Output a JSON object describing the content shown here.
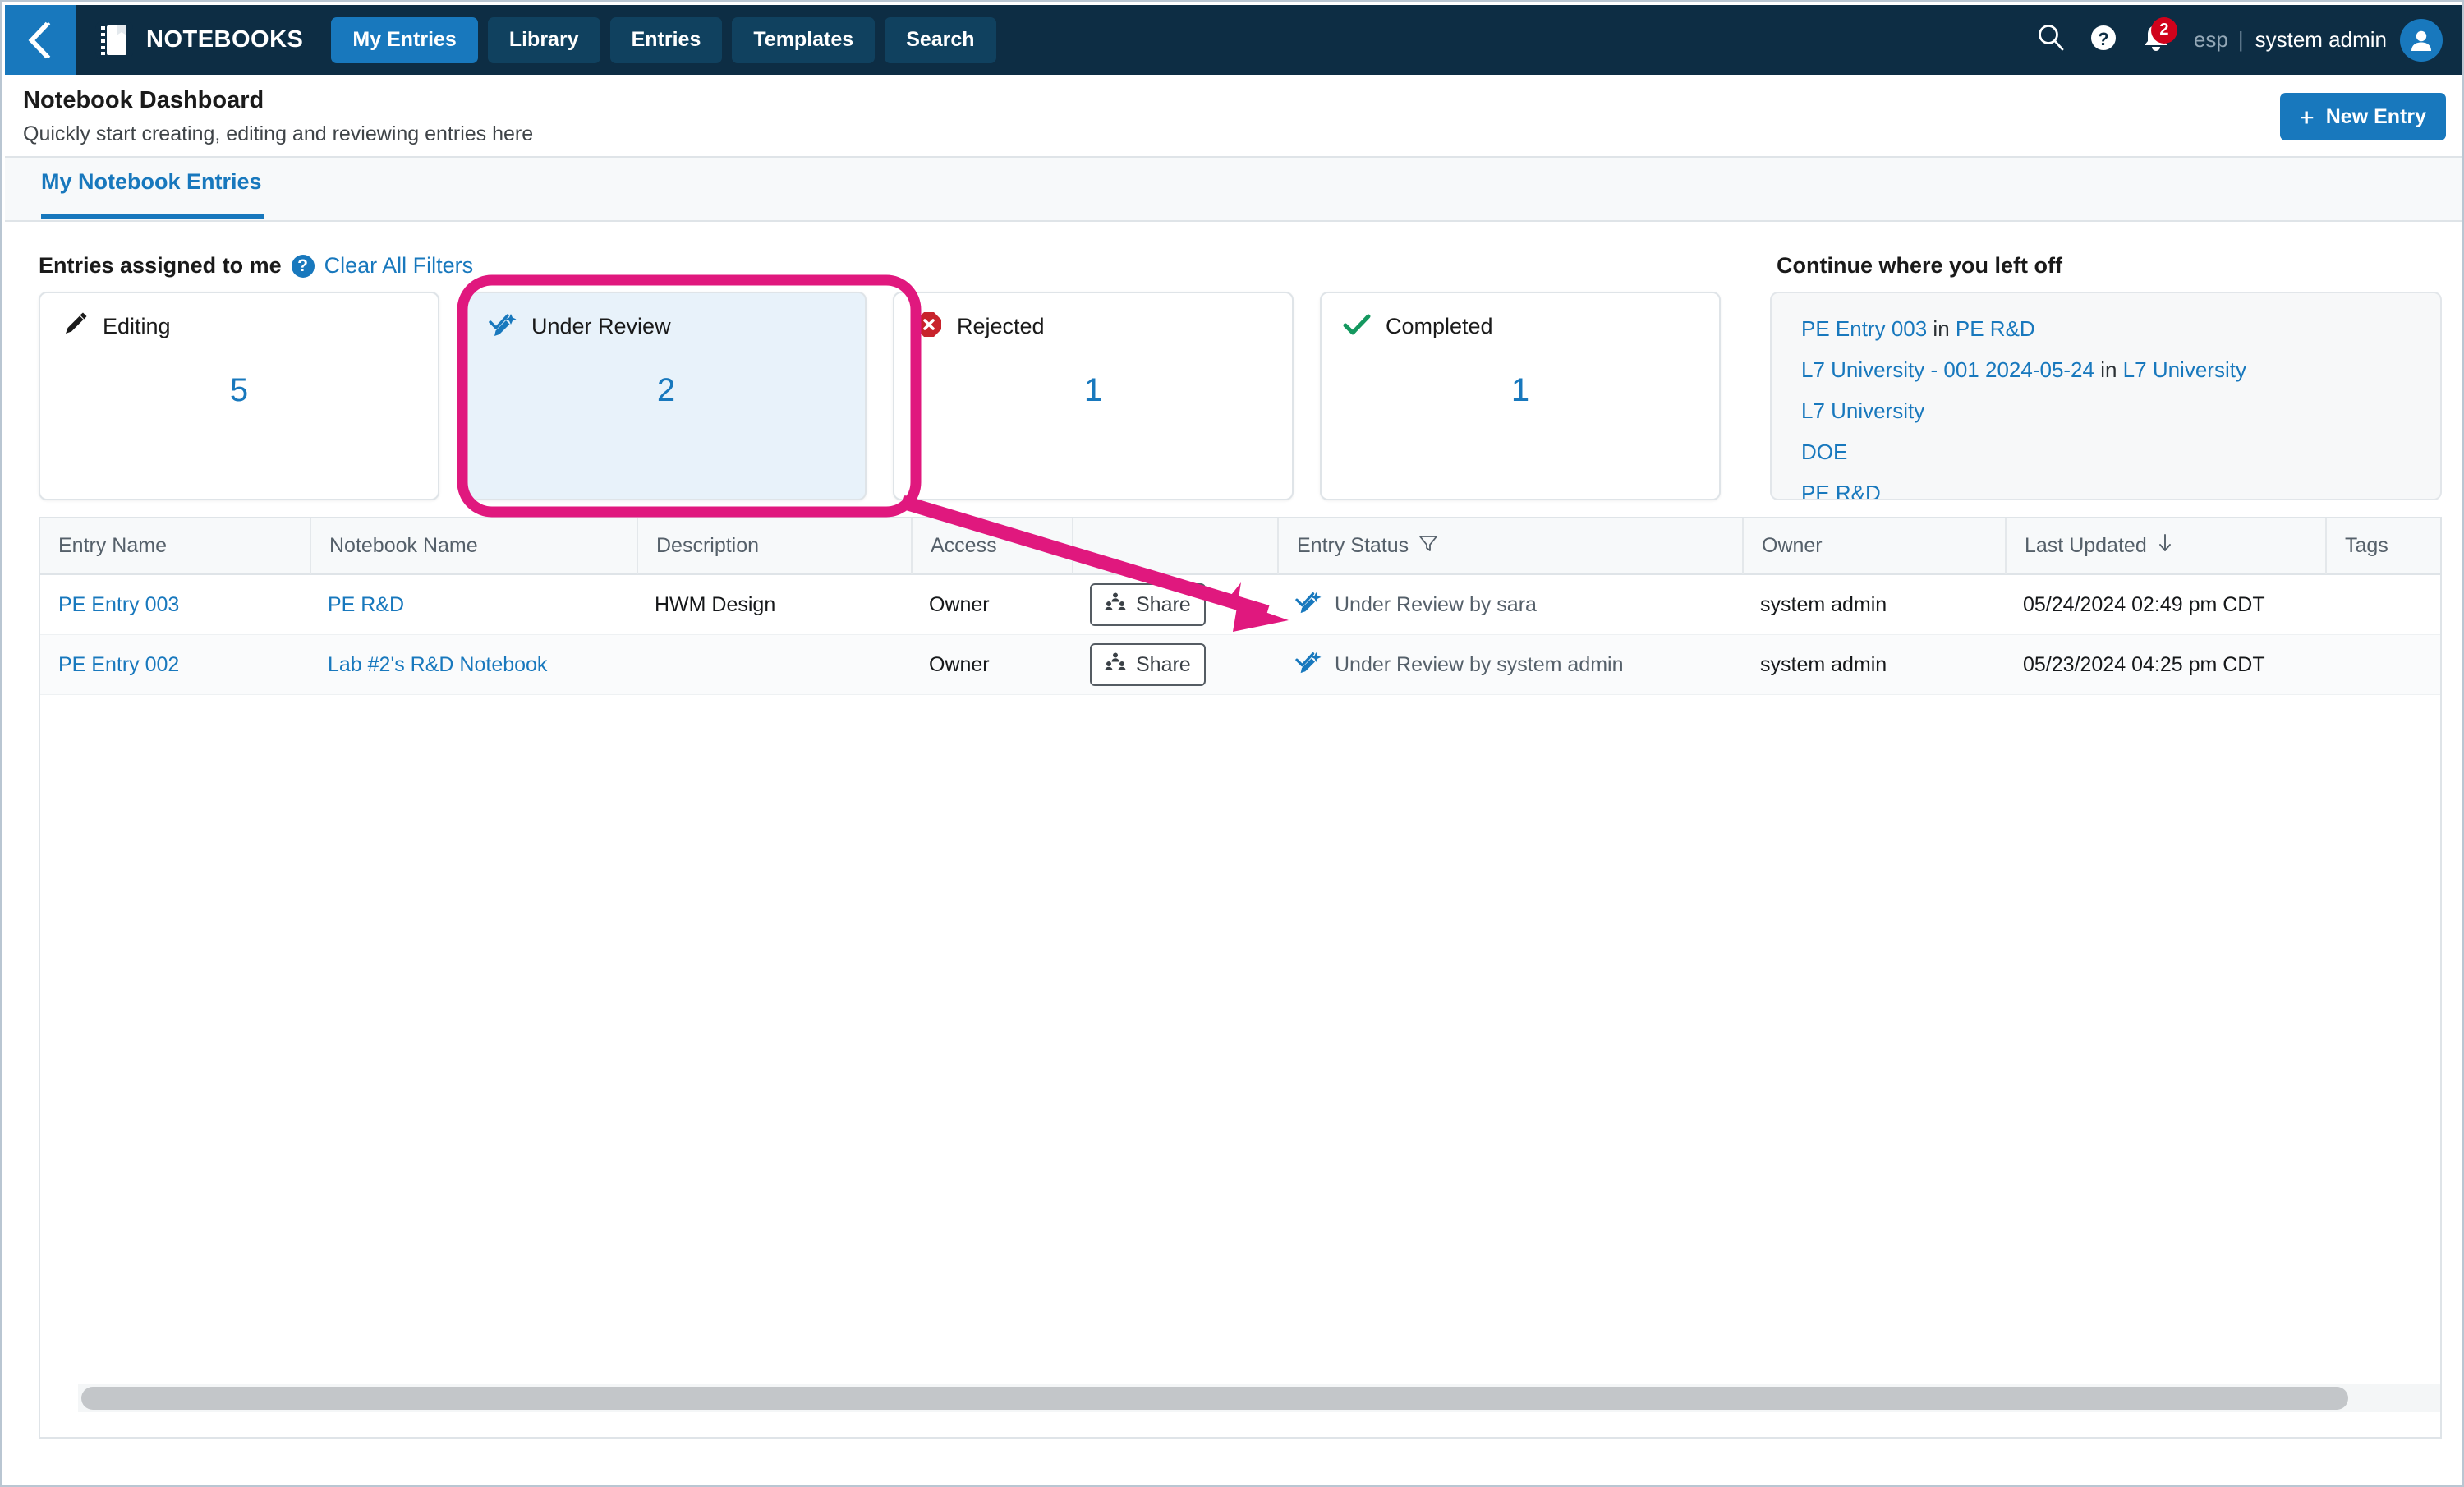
{
  "topnav": {
    "collapse_icon": "chevron-double-left-icon",
    "brand_icon": "notebook-icon",
    "brand": "NOTEBOOKS",
    "tabs": [
      {
        "label": "My Entries",
        "active": true
      },
      {
        "label": "Library",
        "active": false
      },
      {
        "label": "Entries",
        "active": false
      },
      {
        "label": "Templates",
        "active": false
      },
      {
        "label": "Search",
        "active": false
      }
    ],
    "search_icon": "search-icon",
    "help_icon": "help-circle-icon",
    "bell_icon": "bell-icon",
    "notification_count": "2",
    "language": "esp",
    "separator": "|",
    "username": "system admin",
    "avatar_icon": "user-avatar-icon"
  },
  "header": {
    "title": "Notebook Dashboard",
    "subtitle": "Quickly start creating, editing and reviewing entries here",
    "new_entry_label": "New Entry",
    "new_entry_plus": "+"
  },
  "tabstrip": {
    "active_tab": "My Notebook Entries"
  },
  "filters": {
    "label": "Entries assigned to me",
    "help_glyph": "?",
    "clear_all": "Clear All Filters",
    "cards": [
      {
        "label": "Editing",
        "count": "5",
        "icon": "pencil-icon",
        "selected": false
      },
      {
        "label": "Under Review",
        "count": "2",
        "icon": "review-check-pencil-icon",
        "selected": true
      },
      {
        "label": "Rejected",
        "count": "1",
        "icon": "rejected-octagon-x-icon",
        "selected": false
      },
      {
        "label": "Completed",
        "count": "1",
        "icon": "green-check-icon",
        "selected": false
      }
    ]
  },
  "continue": {
    "title": "Continue where you left off",
    "items": [
      {
        "primary": "PE Entry 003",
        "joiner": " in ",
        "secondary": "PE R&D"
      },
      {
        "primary": "L7 University - 001 2024-05-24",
        "joiner": " in ",
        "secondary": "L7 University"
      },
      {
        "primary": "L7 University",
        "joiner": "",
        "secondary": ""
      },
      {
        "primary": "DOE",
        "joiner": "",
        "secondary": ""
      },
      {
        "primary": "PE R&D",
        "joiner": "",
        "secondary": ""
      }
    ]
  },
  "table": {
    "columns": [
      {
        "label": "Entry Name",
        "icon": ""
      },
      {
        "label": "Notebook Name",
        "icon": ""
      },
      {
        "label": "Description",
        "icon": ""
      },
      {
        "label": "Access",
        "icon": ""
      },
      {
        "label": "",
        "icon": ""
      },
      {
        "label": "Entry Status",
        "icon": "filter-funnel-icon"
      },
      {
        "label": "Owner",
        "icon": ""
      },
      {
        "label": "Last Updated",
        "icon": "sort-down-arrow-icon"
      },
      {
        "label": "Tags",
        "icon": ""
      }
    ],
    "rows": [
      {
        "entry_name": "PE Entry 003",
        "notebook_name": "PE R&D",
        "description": "HWM Design",
        "access": "Owner",
        "share_label": "Share",
        "status": "Under Review by sara",
        "status_icon": "review-check-pencil-icon",
        "owner": "system admin",
        "last_updated": "05/24/2024 02:49 pm CDT",
        "tags": ""
      },
      {
        "entry_name": "PE Entry 002",
        "notebook_name": "Lab #2's R&D Notebook",
        "description": "",
        "access": "Owner",
        "share_label": "Share",
        "status": "Under Review by system admin",
        "status_icon": "review-check-pencil-icon",
        "owner": "system admin",
        "last_updated": "05/23/2024 04:25 pm CDT",
        "tags": ""
      }
    ]
  },
  "annotations": {
    "highlight_target": "Under Review",
    "arrow_target": "entry-status-cell",
    "color": "#e0187e"
  },
  "colors": {
    "nav_bg": "#0d2d44",
    "accent_blue": "#1878bd",
    "selected_card_bg": "#e8f2fa",
    "annotation_pink": "#e0187e",
    "reject_red": "#c8232c",
    "complete_green": "#14985f"
  }
}
